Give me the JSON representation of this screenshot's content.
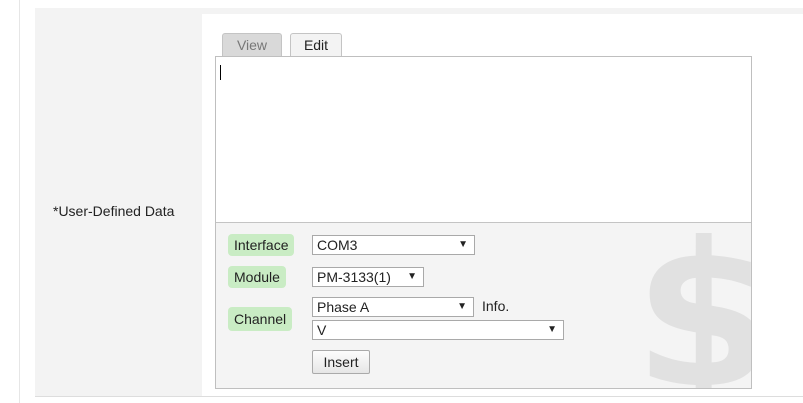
{
  "form": {
    "field_label": "*User-Defined Data"
  },
  "tabs": {
    "view_label": "View",
    "edit_label": "Edit",
    "active": "Edit"
  },
  "editor": {
    "content": ""
  },
  "insert_panel": {
    "interface_label": "Interface",
    "interface_value": "COM3",
    "module_label": "Module",
    "module_value": "PM-3133(1)",
    "channel_label": "Channel",
    "channel_value": "Phase A",
    "info_label": "Info.",
    "info_value": "V",
    "insert_label": "Insert",
    "watermark_symbol": "$"
  },
  "icons": {
    "dropdown_arrow": "▼"
  },
  "colors": {
    "tag_background": "#c9ecc4",
    "label_cell_background": "#f3f3f3",
    "panel_background": "#f4f4f4",
    "watermark": "#e1e1e1"
  }
}
